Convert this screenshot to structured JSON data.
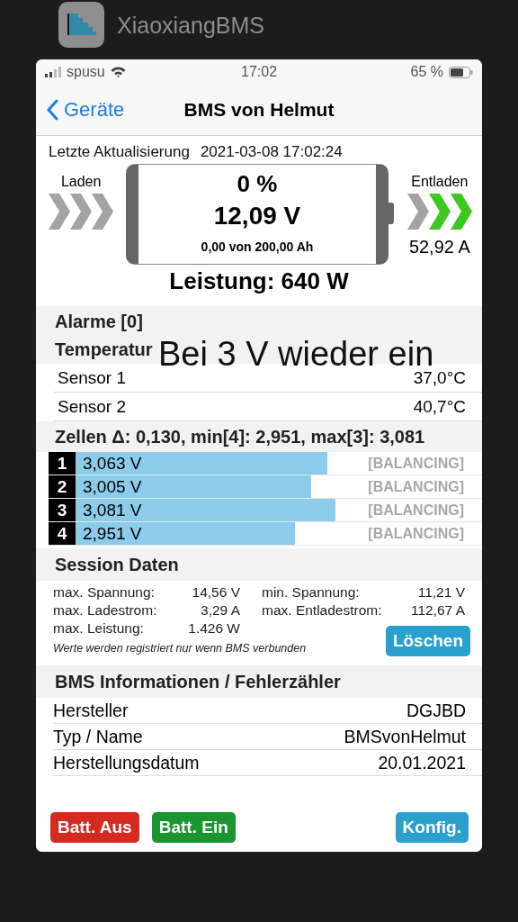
{
  "app_switcher": {
    "app_name": "XiaoxiangBMS"
  },
  "status_bar": {
    "carrier": "spusu",
    "time": "17:02",
    "battery": "65 %"
  },
  "nav": {
    "back": "Geräte",
    "title": "BMS von Helmut"
  },
  "update": {
    "label": "Letzte Aktualisierung",
    "value": "2021-03-08 17:02:24"
  },
  "flow": {
    "charge": {
      "label": "Laden",
      "chevrons": [
        {
          "on": false
        },
        {
          "on": false
        },
        {
          "on": false
        }
      ]
    },
    "discharge": {
      "label": "Entladen",
      "chevrons": [
        {
          "on": false
        },
        {
          "on": true
        },
        {
          "on": true
        }
      ],
      "current": "52,92 A"
    }
  },
  "battery": {
    "percent": "0 %",
    "voltage": "12,09 V",
    "capacity": "0,00 von 200,00 Ah"
  },
  "power": "Leistung: 640 W",
  "alarms": {
    "title": "Alarme [0]"
  },
  "temperature": {
    "title": "Temperatur",
    "sensors": [
      {
        "name": "Sensor 1",
        "value": "37,0°C"
      },
      {
        "name": "Sensor 2",
        "value": "40,7°C"
      }
    ]
  },
  "toast": "Bei 3 V wieder ein",
  "cells": {
    "title": "Zellen Δ: 0,130, min[4]: 2,951, max[3]: 3,081",
    "items": [
      {
        "index": "1",
        "voltage": "3,063 V",
        "level": 0.62,
        "status": "[BALANCING]",
        "balancing": false
      },
      {
        "index": "2",
        "voltage": "3,005 V",
        "level": 0.58,
        "status": "[BALANCING]",
        "balancing": false
      },
      {
        "index": "3",
        "voltage": "3,081 V",
        "level": 0.64,
        "status": "[BALANCING]",
        "balancing": false
      },
      {
        "index": "4",
        "voltage": "2,951 V",
        "level": 0.54,
        "status": "[BALANCING]",
        "balancing": false
      }
    ]
  },
  "session": {
    "title": "Session Daten",
    "stats": [
      {
        "label": "max. Spannung:",
        "value": "14,56 V"
      },
      {
        "label": "min. Spannung:",
        "value": "11,21 V"
      },
      {
        "label": "max. Ladestrom:",
        "value": "3,29 A"
      },
      {
        "label": "max. Entladestrom:",
        "value": "112,67 A"
      },
      {
        "label": "max. Leistung:",
        "value": "1.426 W"
      }
    ],
    "note": "Werte werden registriert nur wenn BMS verbunden",
    "clear_button": "Löschen"
  },
  "info": {
    "title": "BMS Informationen / Fehlerzähler",
    "rows": [
      {
        "label": "Hersteller",
        "value": "DGJBD"
      },
      {
        "label": "Typ / Name",
        "value": "BMSvonHelmut"
      },
      {
        "label": "Herstellungsdatum",
        "value": "20.01.2021"
      }
    ]
  },
  "footer": {
    "buttons": [
      {
        "label": "Batt. Aus",
        "color": "#d52a1f"
      },
      {
        "label": "Batt. Ein",
        "color": "#1a952f"
      },
      {
        "label": "Konfig.",
        "color": "#2aa0cf"
      }
    ]
  }
}
